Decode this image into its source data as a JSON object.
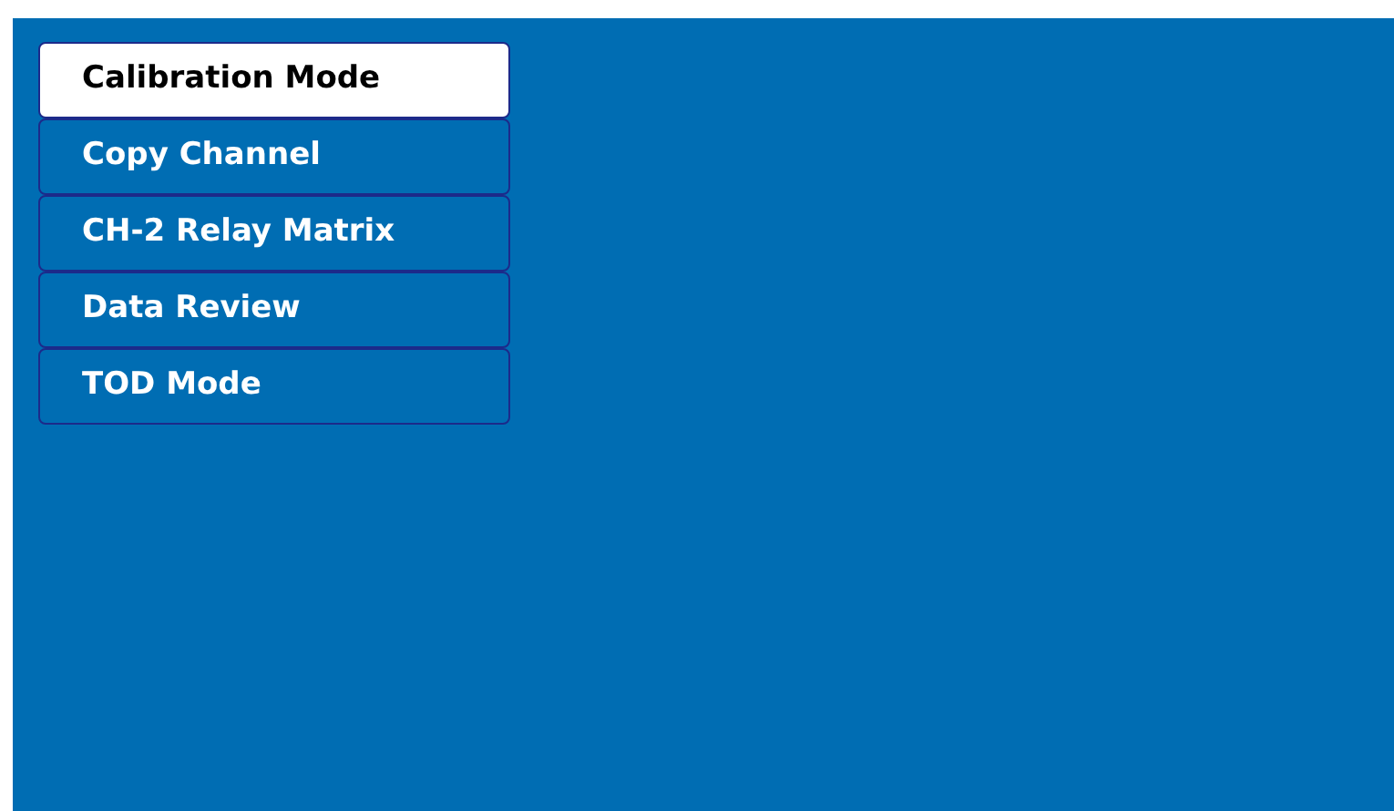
{
  "menu": [
    {
      "label": "Calibration Mode",
      "selected": true
    },
    {
      "label": "Copy Channel",
      "selected": false
    },
    {
      "label": "CH-2 Relay Matrix",
      "selected": false
    },
    {
      "label": "Data Review",
      "selected": false
    },
    {
      "label": "TOD Mode",
      "selected": false
    }
  ]
}
